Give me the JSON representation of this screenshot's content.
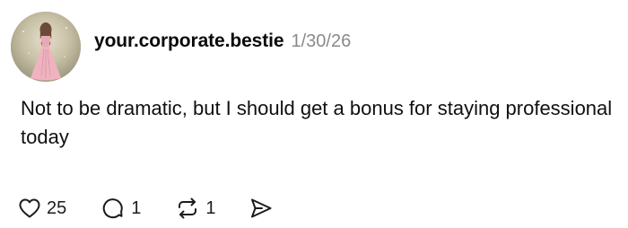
{
  "post": {
    "username": "your.corporate.bestie",
    "timestamp": "1/30/26",
    "text": "Not to be dramatic, but I should get a bonus for staying professional today",
    "avatar_icon": "profile-photo-woman-pink-dress",
    "actions": {
      "like": {
        "icon": "heart-icon",
        "count": "25"
      },
      "reply": {
        "icon": "comment-bubble-icon",
        "count": "1"
      },
      "repost": {
        "icon": "repost-icon",
        "count": "1"
      },
      "share": {
        "icon": "send-icon"
      }
    }
  },
  "colors": {
    "text": "#101010",
    "muted": "#8a8a8a",
    "icon": "#1c1c1c",
    "background": "#ffffff"
  }
}
